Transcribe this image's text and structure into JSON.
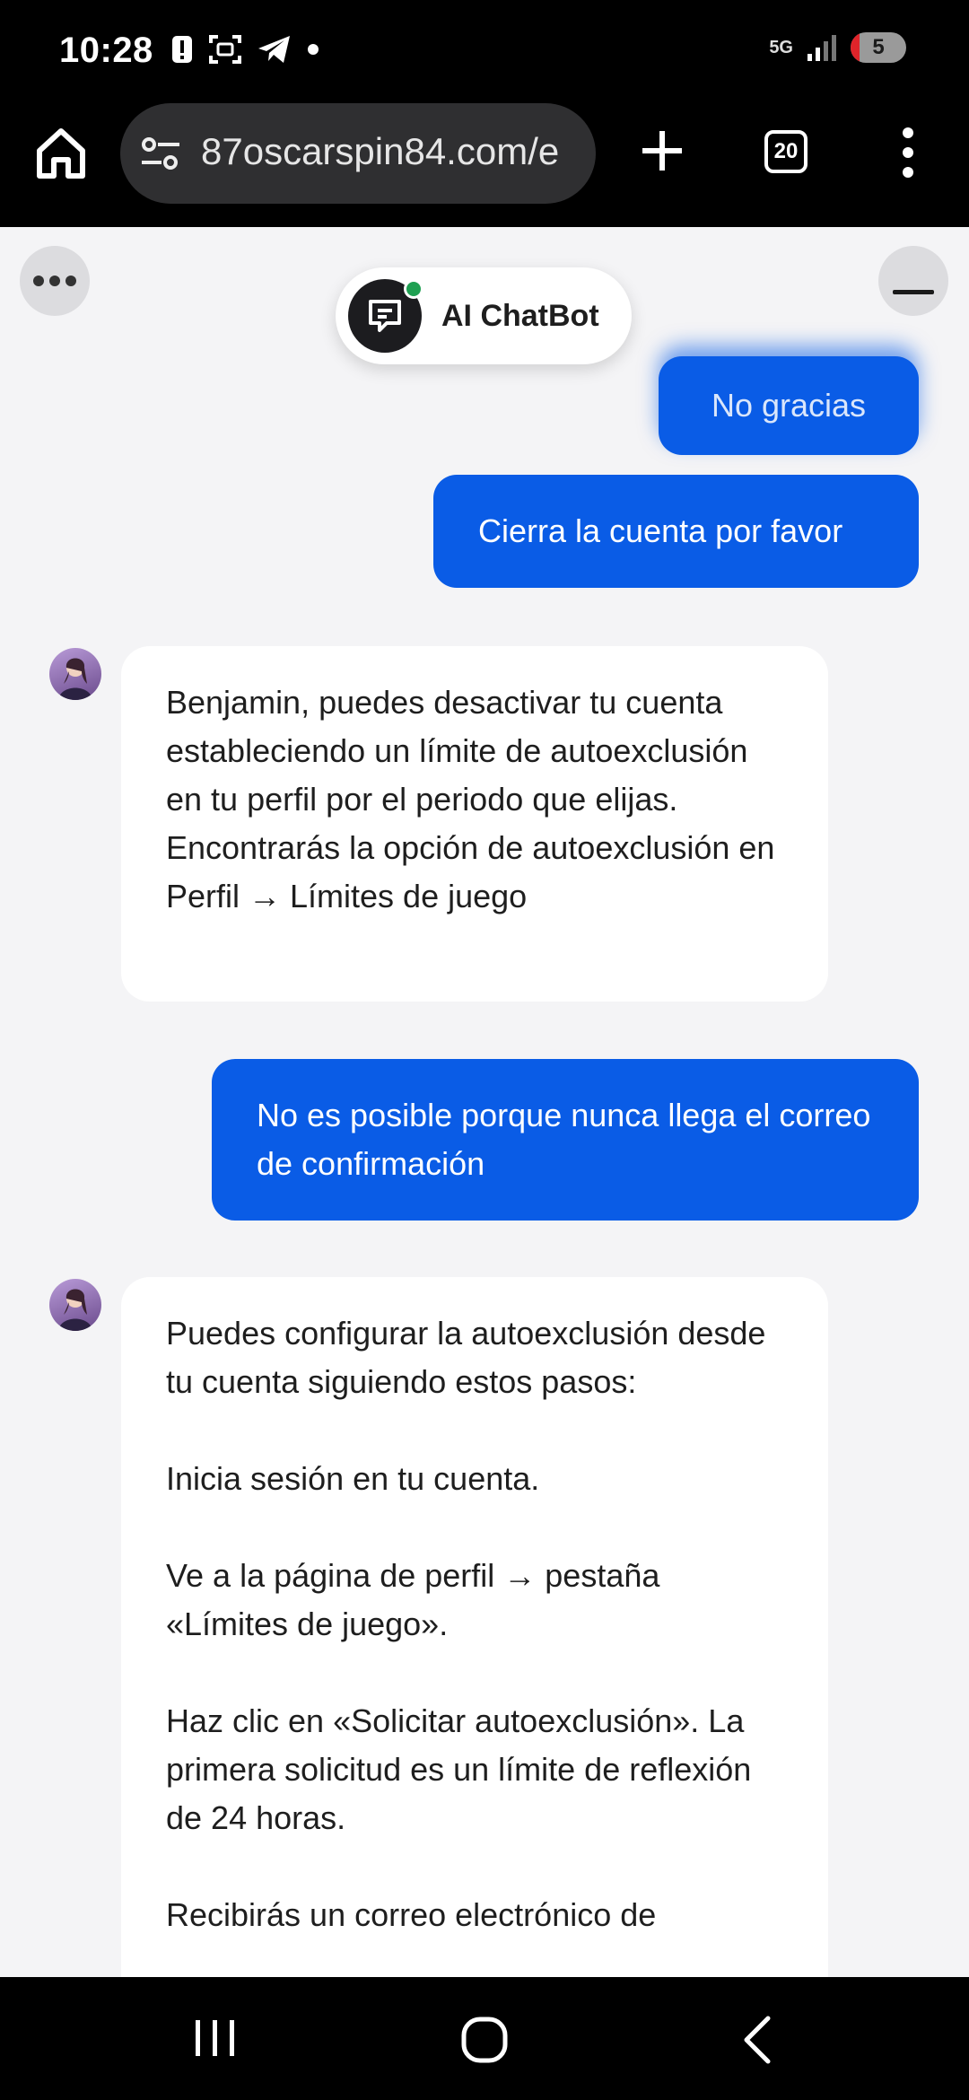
{
  "status_bar": {
    "time": "10:28",
    "network": "5G",
    "battery": "5"
  },
  "browser": {
    "url": "87oscarspin84.com/e",
    "tab_count": "20"
  },
  "chat": {
    "bot_name": "AI ChatBot",
    "messages": [
      {
        "role": "user",
        "text": "No gracias"
      },
      {
        "role": "user",
        "text": "Cierra la cuenta por favor"
      },
      {
        "role": "bot",
        "text": "Benjamin, puedes desactivar tu cuenta estableciendo un límite de autoexclusión en tu perfil por el periodo que elijas. Encontrarás la opción de autoexclusión en Perfil → Límites de juego"
      },
      {
        "role": "user",
        "text": "No es posible porque nunca llega el correo de confirmación"
      },
      {
        "role": "bot",
        "text": "Puedes configurar la autoexclusión desde tu cuenta siguiendo estos pasos:\n\nInicia sesión en tu cuenta.\n\nVe a la página de perfil → pestaña «Límites de juego».\n\nHaz clic en «Solicitar autoexclusión». La primera solicitud es un límite de reflexión de 24 horas.\n\nRecibirás un correo electrónico de"
      }
    ]
  },
  "colors": {
    "user_bubble": "#0a5ce6",
    "online_dot": "#1fa052",
    "background": "#f4f4f6"
  }
}
